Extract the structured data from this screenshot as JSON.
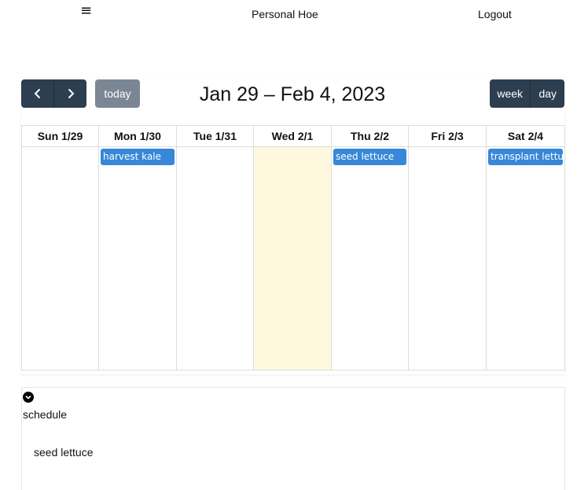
{
  "nav": {
    "menu_glyph": "≡",
    "title": "Personal Hoe",
    "logout": "Logout"
  },
  "toolbar": {
    "prev_icon": "chevron-left-icon",
    "next_icon": "chevron-right-icon",
    "today": "today",
    "range_title": "Jan 29 – Feb 4, 2023",
    "views": [
      "week",
      "day"
    ]
  },
  "days": [
    {
      "label": "Sun 1/29",
      "today": false,
      "event": ""
    },
    {
      "label": "Mon 1/30",
      "today": false,
      "event": "harvest kale"
    },
    {
      "label": "Tue 1/31",
      "today": false,
      "event": ""
    },
    {
      "label": "Wed 2/1",
      "today": true,
      "event": ""
    },
    {
      "label": "Thu 2/2",
      "today": false,
      "event": "seed lettuce"
    },
    {
      "label": "Fri 2/3",
      "today": false,
      "event": ""
    },
    {
      "label": "Sat 2/4",
      "today": false,
      "event": "transplant lettuce"
    }
  ],
  "colors": {
    "button_bg": "#2c3e50",
    "today_button_bg": "#6c7a89",
    "event_bg": "#3788d8",
    "today_col_bg": "#fef8de",
    "grid_border": "#dddddd"
  },
  "schedule": {
    "toggle_icon": "chevron-down-icon",
    "label": "schedule",
    "items": [
      "seed lettuce"
    ]
  }
}
